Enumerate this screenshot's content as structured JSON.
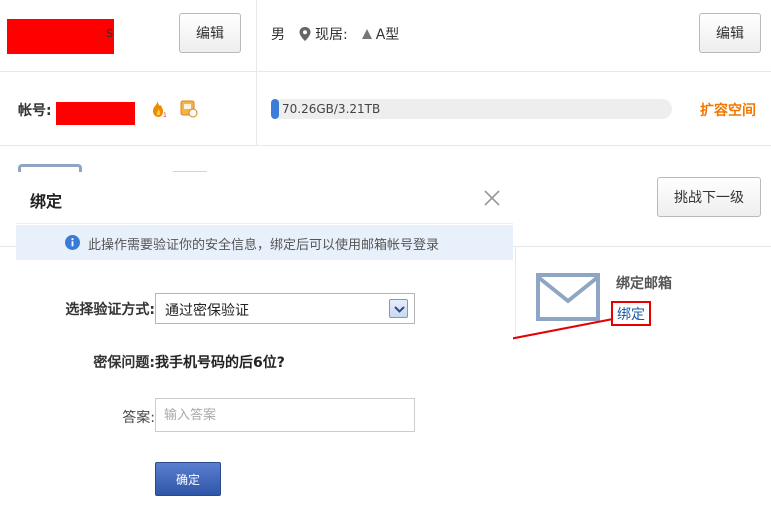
{
  "profile": {
    "name_tail": "s",
    "edit_label": "编辑",
    "gender": "男",
    "location_label": "现居:",
    "blood_type": "A型",
    "edit_label_2": "编辑"
  },
  "account": {
    "label": "帐号:",
    "quota_text": "70.26GB/3.21TB",
    "quota_used_fraction": 0.02,
    "expand_label": "扩容空间"
  },
  "level": {
    "challenge_label": "挑战下一级"
  },
  "bind_panel": {
    "title": "绑定邮箱",
    "link_label": "绑定"
  },
  "dialog": {
    "title": "绑定",
    "notice": "此操作需要验证你的安全信息，绑定后可以使用邮箱帐号登录",
    "method_label": "选择验证方式:",
    "method_value": "通过密保验证",
    "question_label": "密保问题:",
    "question_text": "我手机号码的后6位?",
    "answer_label": "答案:",
    "answer_placeholder": "输入答案",
    "answer_value": "",
    "confirm_label": "确定"
  },
  "colors": {
    "accent_orange": "#f07800",
    "link_blue": "#1a5aa6",
    "annotation_red": "#e60000",
    "primary_button": "#2f56a8"
  }
}
